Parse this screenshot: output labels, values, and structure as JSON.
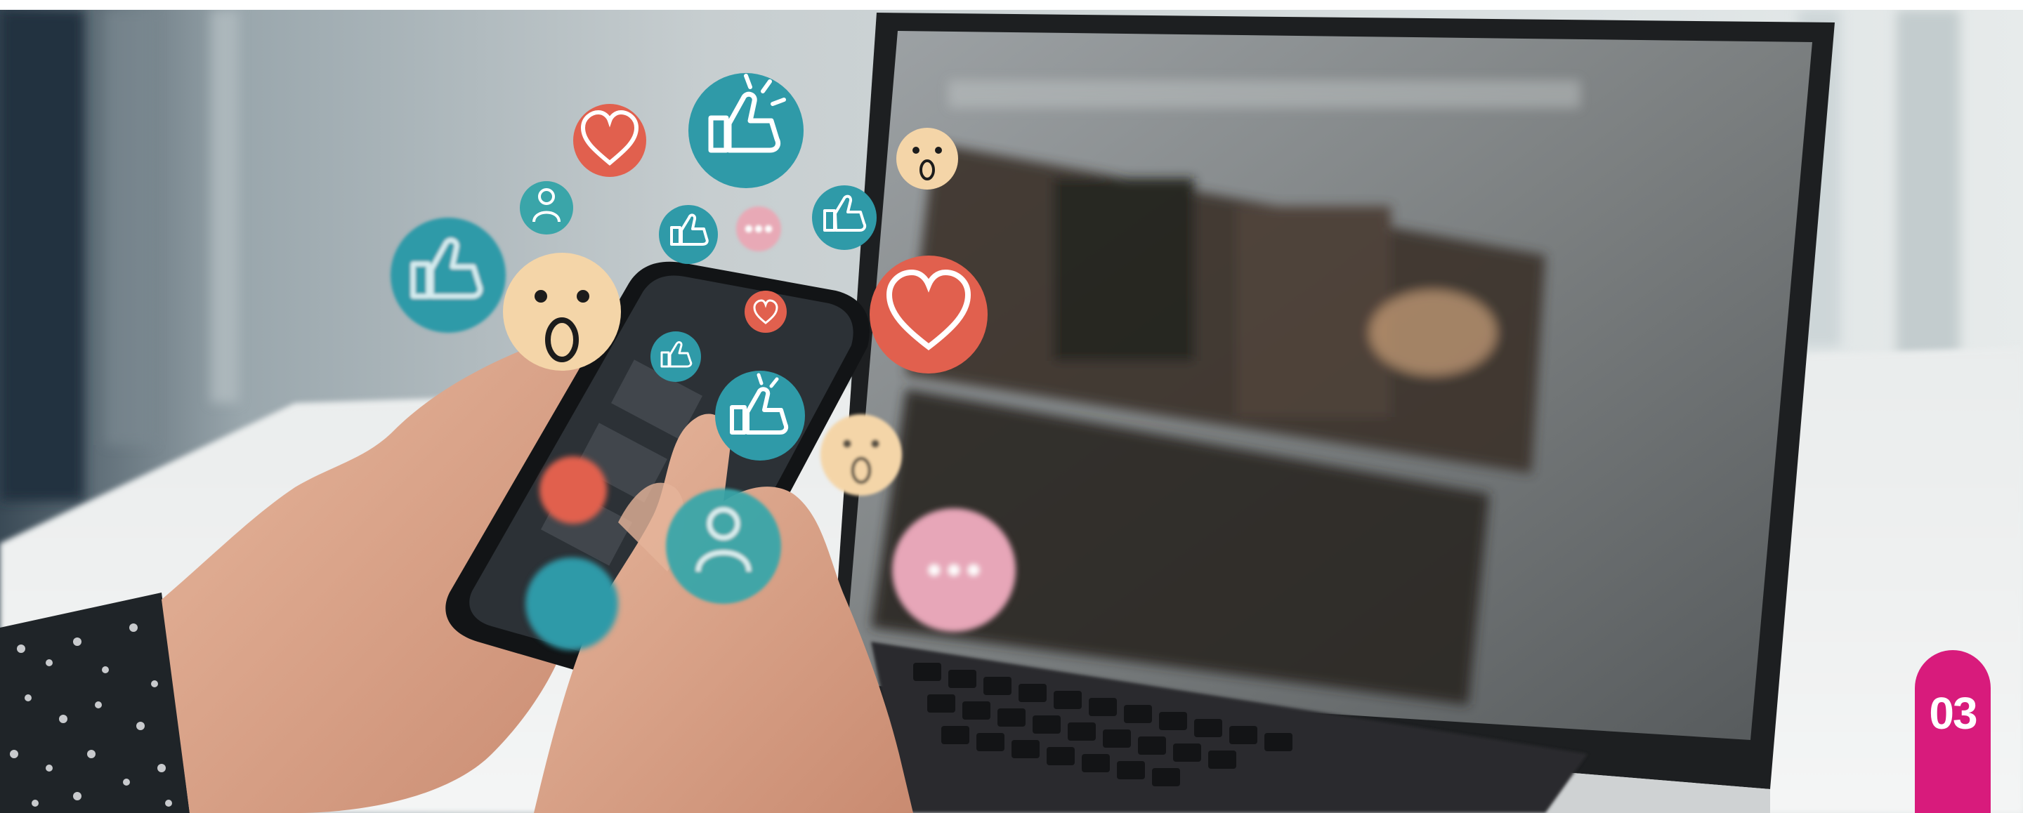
{
  "page_number": "03",
  "colors": {
    "badge": "#d81b7c",
    "teal_bubble": "#2f9aa8",
    "red_bubble": "#e1604e",
    "emoji_face": "#f4d5a8",
    "pink_bubble": "#e7a6b8"
  },
  "reaction_icons": [
    "heart-icon",
    "thumbs-up-icon",
    "surprised-face-icon",
    "person-icon",
    "chat-dots-icon"
  ]
}
